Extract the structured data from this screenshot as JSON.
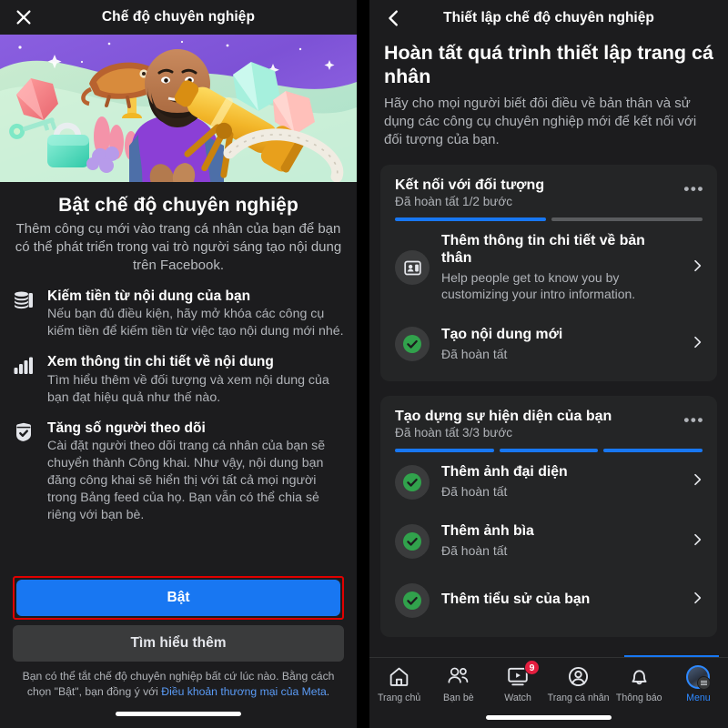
{
  "left": {
    "topbar": {
      "close_icon": "close-icon",
      "title": "Chế độ chuyên nghiệp"
    },
    "hero": {
      "alt": "professional-mode-illustration"
    },
    "heading": "Bật chế độ chuyên nghiệp",
    "subheading": "Thêm công cụ mới vào trang cá nhân của bạn để bạn có thể phát triển trong vai trò người sáng tạo nội dung trên Facebook.",
    "features": [
      {
        "icon": "coins-stack-icon",
        "title": "Kiếm tiền từ nội dung của bạn",
        "desc": "Nếu bạn đủ điều kiện, hãy mở khóa các công cụ kiếm tiền để kiếm tiền từ việc tạo nội dung mới nhé."
      },
      {
        "icon": "bar-chart-icon",
        "title": "Xem thông tin chi tiết về nội dung",
        "desc": "Tìm hiểu thêm về đối tượng và xem nội dung của bạn đạt hiệu quả như thế nào."
      },
      {
        "icon": "badge-check-icon",
        "title": "Tăng số người theo dõi",
        "desc": "Cài đặt người theo dõi trang cá nhân của bạn sẽ chuyển thành Công khai. Như vậy, nội dung bạn đăng công khai sẽ hiển thị với tất cả mọi người trong Bảng feed của họ. Bạn vẫn có thể chia sẻ riêng với bạn bè."
      }
    ],
    "primary_button": "Bật",
    "secondary_button": "Tìm hiểu thêm",
    "legal_prefix": "Bạn có thể tắt chế độ chuyên nghiệp bất cứ lúc nào. Bằng cách chọn \"Bật\", bạn đồng ý với ",
    "legal_link": "Điều khoản thương mại của Meta",
    "legal_suffix": ".",
    "highlight_color": "#e00000",
    "accent_color": "#1877F2"
  },
  "right": {
    "topbar": {
      "back_icon": "chevron-left-icon",
      "title": "Thiết lập chế độ chuyên nghiệp"
    },
    "heading": "Hoàn tất quá trình thiết lập trang cá nhân",
    "subheading": "Hãy cho mọi người biết đôi điều về bản thân và sử dụng các công cụ chuyên nghiệp mới để kết nối với đối tượng của bạn.",
    "cards": [
      {
        "title": "Kết nối với đối tượng",
        "status": "Đã hoàn tất 1/2 bước",
        "menu_icon": "more-options-icon",
        "progress_total": 2,
        "progress_done": 1,
        "tasks": [
          {
            "icon": "profile-details-icon",
            "state": "pending",
            "title": "Thêm thông tin chi tiết về bản thân",
            "desc": "Help people get to know you by customizing your intro information."
          },
          {
            "icon": "check-circle-icon",
            "state": "done",
            "title": "Tạo nội dung mới",
            "desc": "Đã hoàn tất"
          }
        ]
      },
      {
        "title": "Tạo dựng sự hiện diện của bạn",
        "status": "Đã hoàn tất 3/3 bước",
        "menu_icon": "more-options-icon",
        "progress_total": 3,
        "progress_done": 3,
        "tasks": [
          {
            "icon": "check-circle-icon",
            "state": "done",
            "title": "Thêm ảnh đại diện",
            "desc": "Đã hoàn tất"
          },
          {
            "icon": "check-circle-icon",
            "state": "done",
            "title": "Thêm ảnh bìa",
            "desc": "Đã hoàn tất"
          },
          {
            "icon": "check-circle-icon",
            "state": "done",
            "title": "Thêm tiểu sử của bạn",
            "desc": ""
          }
        ]
      }
    ],
    "tabbar": [
      {
        "icon": "home-icon",
        "label": "Trang chủ",
        "active": false,
        "badge": ""
      },
      {
        "icon": "friends-icon",
        "label": "Bạn bè",
        "active": false,
        "badge": ""
      },
      {
        "icon": "watch-icon",
        "label": "Watch",
        "active": false,
        "badge": "9"
      },
      {
        "icon": "profile-icon",
        "label": "Trang cá nhân",
        "active": false,
        "badge": ""
      },
      {
        "icon": "bell-icon",
        "label": "Thông báo",
        "active": false,
        "badge": ""
      },
      {
        "icon": "menu-avatar-icon",
        "label": "Menu",
        "active": true,
        "badge": ""
      }
    ],
    "accent_color": "#1877F2",
    "done_color": "#31a24c",
    "badge_color": "#e41e3f"
  }
}
